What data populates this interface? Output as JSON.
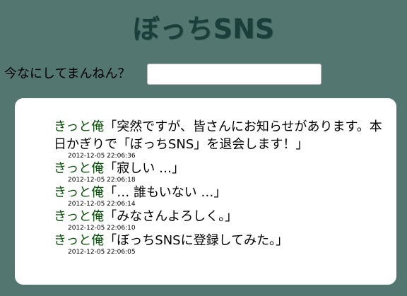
{
  "header": {
    "title": "ぼっちSNS"
  },
  "composer": {
    "prompt": "今なにしてまんねん？",
    "value": "",
    "placeholder": ""
  },
  "timeline": {
    "posts": [
      {
        "author": "きっと俺",
        "text": "「突然ですが、皆さんにお知らせがあります。本日かぎりで「ぼっちSNS」を退会します！」",
        "time": "2012-12-05 22:06:36"
      },
      {
        "author": "きっと俺",
        "text": "「寂しい …」",
        "time": "2012-12-05 22:06:18"
      },
      {
        "author": "きっと俺",
        "text": "「… 誰もいない …」",
        "time": "2012-12-05 22:06:14"
      },
      {
        "author": "きっと俺",
        "text": "「みなさんよろしく。」",
        "time": "2012-12-05 22:06:10"
      },
      {
        "author": "きっと俺",
        "text": "「ぼっちSNSに登録してみた。」",
        "time": "2012-12-05 22:06:05"
      }
    ]
  }
}
